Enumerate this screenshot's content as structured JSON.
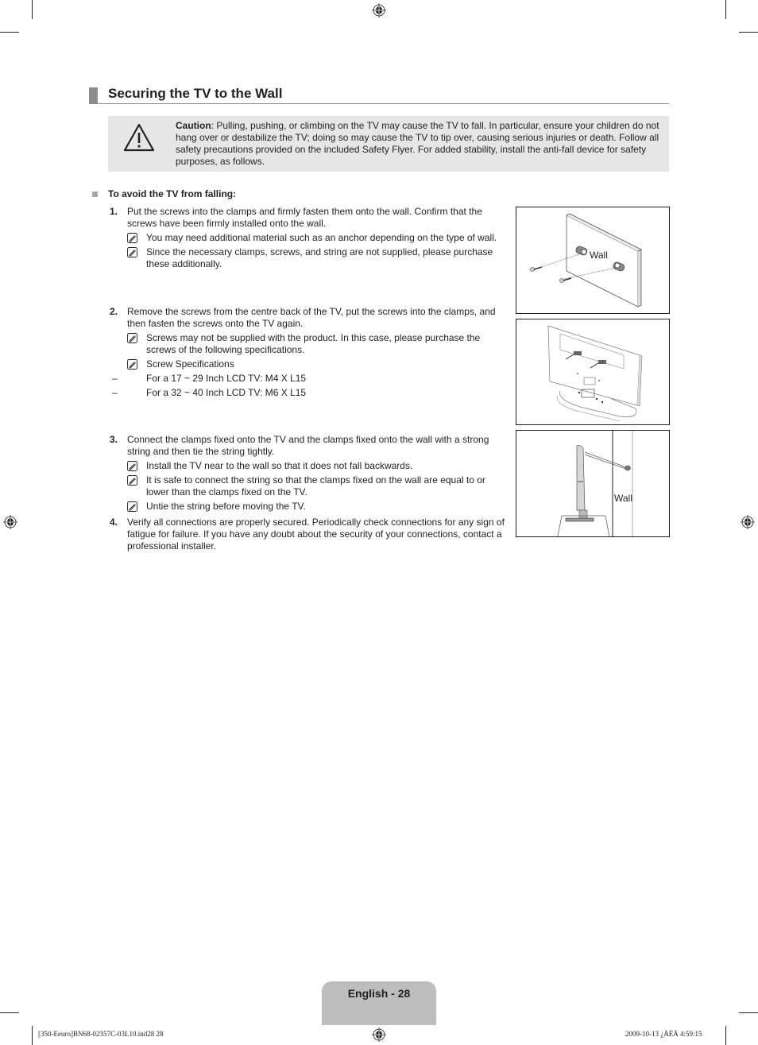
{
  "section": {
    "title": "Securing the TV to the Wall"
  },
  "caution": {
    "icon": "warning-triangle-icon",
    "label": "Caution",
    "text": ": Pulling, pushing, or climbing on the TV may cause the TV to fall. In particular, ensure your children do not hang over or destabilize the TV; doing so may cause the TV to tip over, causing serious injuries or death. Follow all safety precautions provided on the included Safety Flyer. For added stability, install the anti-fall device for safety purposes, as follows."
  },
  "subheading": "To avoid the TV from falling:",
  "steps": [
    {
      "num": "1.",
      "text": "Put the screws into the clamps and firmly fasten them onto the wall. Confirm that the screws have been firmly installed onto the wall.",
      "notes": [
        "You may need additional material such as an anchor depending on the type of wall.",
        "Since the necessary clamps, screws, and string are not supplied, please purchase these additionally."
      ]
    },
    {
      "num": "2.",
      "text": "Remove the screws from the centre back of the TV, put the screws into the clamps, and then fasten the screws onto the TV again.",
      "notes": [
        "Screws may not be supplied with the product. In this case, please purchase the screws of the following specifications.",
        "Screw Specifications"
      ],
      "specs": [
        "For a 17 ~ 29 Inch LCD TV: M4 X L15",
        "For a 32 ~ 40 Inch LCD TV: M6 X L15"
      ]
    },
    {
      "num": "3.",
      "text": "Connect the clamps fixed onto the TV and the clamps fixed onto the wall with a strong string and then tie the string tightly.",
      "notes": [
        "Install the TV near to the wall so that it does not fall backwards.",
        "It is safe to connect the string so that the clamps fixed on the wall are equal to or lower than the clamps fixed on the TV.",
        "Untie the string before moving the TV."
      ]
    },
    {
      "num": "4.",
      "text": "Verify all connections are properly secured. Periodically check connections for any sign of fatigue for failure. If you have any doubt about the security of your connections, contact a professional installer."
    }
  ],
  "figures": {
    "fig1_label": "Wall",
    "fig3_label": "Wall"
  },
  "footer": {
    "page_label": "English - 28",
    "slug_left": "[350-Eeuro]BN68-02357C-03L10.ind28   28",
    "slug_right": "2009-10-13   ¿ÀÈÄ 4:59:15"
  }
}
